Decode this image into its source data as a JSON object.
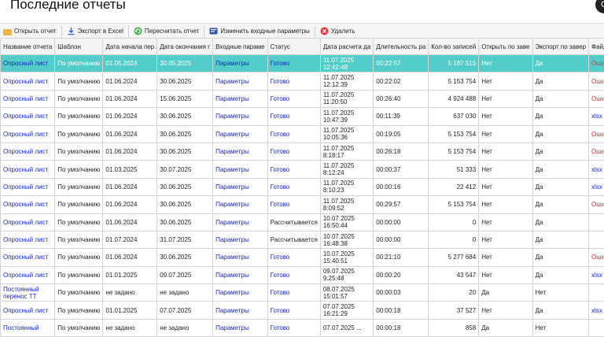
{
  "page": {
    "title": "Последние отчеты",
    "corner_glyph": "С"
  },
  "toolbar": {
    "open_report": "Открыть отчет",
    "export_excel": "Экспорт в Excel",
    "recalculate": "Пересчитать отчет",
    "change_params": "Изменить входные параметры",
    "delete": "Удалить"
  },
  "colors": {
    "selected_row": "#53cdc9",
    "link": "#1526c8",
    "error": "#ef1c1c",
    "toolbar_bg": "#f6f6f6"
  },
  "table": {
    "headers": [
      "Название отчета",
      "Шаблон",
      "Дата начала пер",
      "Дата окончания г",
      "Входные параме",
      "Статус",
      "Дата расчета дa",
      "Длительность ра",
      "Кол-во записей",
      "Открыть по заве",
      "Экспорт по завер",
      "Файл"
    ],
    "rows": [
      [
        "Опросный лист",
        "По умолчанию",
        "01.05.2024",
        "30.05.2025",
        "Параметры",
        "Готово",
        "11.07.2025 12:42:48",
        "00:22:57",
        "5 187 515",
        "Нет",
        "Да",
        "Ошибка"
      ],
      [
        "Опросный лист",
        "По умолчанию",
        "01.06.2024",
        "30.06.2025",
        "Параметры",
        "Готово",
        "11.07.2025 12:12:39",
        "00:22:02",
        "5 153 754",
        "Нет",
        "Да",
        "Ошибка"
      ],
      [
        "Опросный лист",
        "По умолчанию",
        "01.06.2024",
        "15.06.2025",
        "Параметры",
        "Готово",
        "11.07.2025 11:20:50",
        "00:26:40",
        "4 924 488",
        "Нет",
        "Да",
        "Ошибка"
      ],
      [
        "Опросный лист",
        "По умолчанию",
        "01.06.2024",
        "30.06.2025",
        "Параметры",
        "Готово",
        "11.07.2025 10:47:39",
        "00:11:39",
        "637 030",
        "Нет",
        "Да",
        "xlsx"
      ],
      [
        "Опросный лист",
        "По умолчанию",
        "01.06.2024",
        "30.06.2025",
        "Параметры",
        "Готово",
        "11.07.2025 10:05:36",
        "00:19:05",
        "5 153 754",
        "Нет",
        "Да",
        "Ошибка"
      ],
      [
        "Опросный лист",
        "По умолчанию",
        "01.06.2024",
        "30.06.2025",
        "Параметры",
        "Готово",
        "11.07.2025 8:18:17",
        "00:26:18",
        "5 153 754",
        "Нет",
        "Да",
        "Ошибка"
      ],
      [
        "Опросный лист",
        "По умолчанию",
        "01.03.2025",
        "30.07.2025",
        "Параметры",
        "Готово",
        "11.07.2025 8:12:24",
        "00:00:37",
        "51 333",
        "Нет",
        "Да",
        "xlsx"
      ],
      [
        "Опросный лист",
        "По умолчанию",
        "01.06.2024",
        "30.06.2025",
        "Параметры",
        "Готово",
        "11.07.2025 8:10:23",
        "00:00:16",
        "22 412",
        "Нет",
        "Да",
        "xlsx"
      ],
      [
        "Опросный лист",
        "По умолчанию",
        "01.06.2024",
        "30.06.2025",
        "Параметры",
        "Готово",
        "11.07.2025 8:09:52",
        "00:29:57",
        "5 153 754",
        "Нет",
        "Да",
        "Ошибка"
      ],
      [
        "Опросный лист",
        "По умолчанию",
        "01.06.2024",
        "30.06.2025",
        "Параметры",
        "Рассчитывается",
        "10.07.2025 16:50:44",
        "00:00:00",
        "0",
        "Нет",
        "Да",
        ""
      ],
      [
        "Опросный лист",
        "По умолчанию",
        "01.07.2024",
        "31.07.2025",
        "Параметры",
        "Рассчитывается",
        "10.07.2025 16:48:38",
        "00:00:00",
        "0",
        "Нет",
        "Да",
        ""
      ],
      [
        "Опросный лист",
        "По умолчанию",
        "01.06.2024",
        "30.06.2025",
        "Параметры",
        "Готово",
        "10.07.2025 15:40:51",
        "00:21:10",
        "5 277 684",
        "Нет",
        "Да",
        "Ошибка"
      ],
      [
        "Опросный лист",
        "По умолчанию",
        "01.01.2025",
        "09.07.2025",
        "Параметры",
        "Готово",
        "09.07.2025 9:25:48",
        "00:00:20",
        "43 547",
        "Нет",
        "Да",
        "xlsx"
      ],
      [
        "Постоянный перенос ТТ",
        "По умолчанию",
        "не задано",
        "не задано",
        "Параметры",
        "Готово",
        "08.07.2025 15:01:57",
        "00:00:03",
        "20",
        "Да",
        "Нет",
        ""
      ],
      [
        "Опросный лист",
        "По умолчанию",
        "01.01.2025",
        "07.07.2025",
        "Параметры",
        "Готово",
        "07.07.2025 16:21:29",
        "00:00:18",
        "37 527",
        "Нет",
        "Да",
        "xlsx"
      ],
      [
        "Постоянный",
        "По умолчанию",
        "не задано",
        "не задано",
        "Параметры",
        "Готово",
        "07.07.2025 ...",
        "00:00:18",
        "858",
        "Да",
        "Нет",
        ""
      ]
    ]
  }
}
